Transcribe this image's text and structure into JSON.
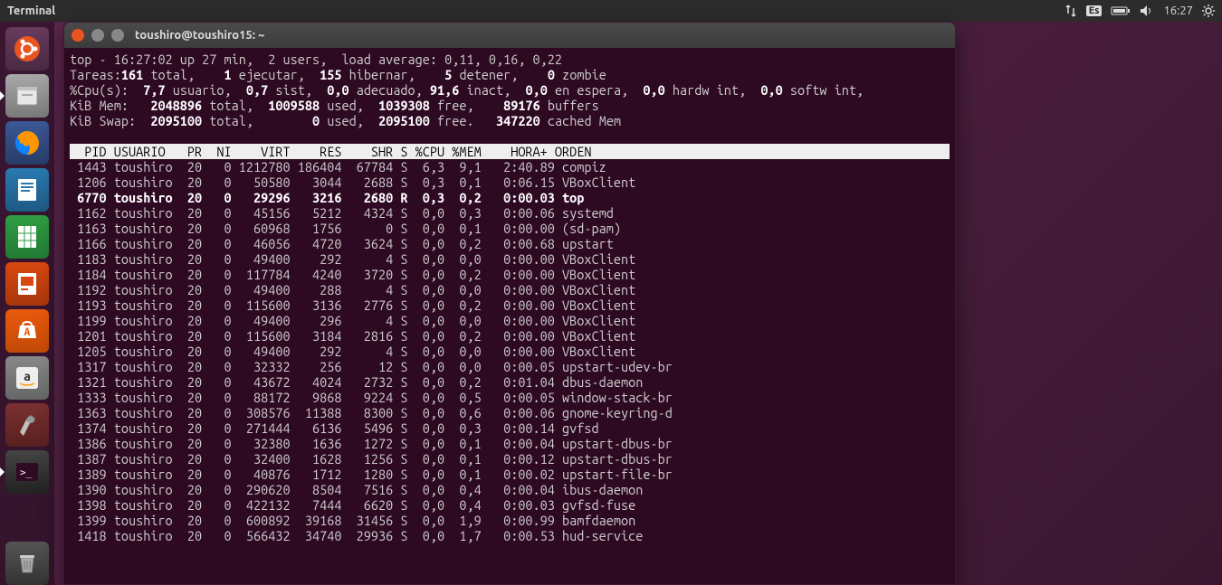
{
  "menubar": {
    "app_title": "Terminal",
    "lang": "Es",
    "clock": "16:27"
  },
  "launcher": {
    "items": [
      {
        "name": "files-icon"
      },
      {
        "name": "firefox-icon"
      },
      {
        "name": "writer-icon"
      },
      {
        "name": "calc-icon"
      },
      {
        "name": "impress-icon"
      },
      {
        "name": "software-icon"
      },
      {
        "name": "amazon-icon"
      },
      {
        "name": "settings-icon"
      },
      {
        "name": "terminal-icon"
      }
    ],
    "trash": "trash-icon"
  },
  "terminal": {
    "title": "toushiro@toushiro15: ~",
    "header": {
      "line1_pre": "top - 16:27:02 up 27 min,  2 users,  load average: 0,11, 0,16, 0,22",
      "tasks_label": "Tareas:",
      "tasks_total": "161",
      "tasks_total_sfx": " total,  ",
      "tasks_run": "  1",
      "tasks_run_sfx": " ejecutar,  ",
      "tasks_sleep": "155",
      "tasks_sleep_sfx": " hibernar,   ",
      "tasks_stop": " 5",
      "tasks_stop_sfx": " detener,   ",
      "tasks_zomb": " 0",
      "tasks_zomb_sfx": " zombie",
      "cpu_label": "%Cpu(s): ",
      "cpu_us": " 7,7",
      "cpu_us_sfx": " usuario, ",
      "cpu_sy": " 0,7",
      "cpu_sy_sfx": " sist, ",
      "cpu_ni": " 0,0",
      "cpu_ni_sfx": " adecuado,",
      "cpu_id": " 91,6",
      "cpu_id_sfx": " inact, ",
      "cpu_wa": " 0,0",
      "cpu_wa_sfx": " en espera, ",
      "cpu_hi": " 0,0",
      "cpu_hi_sfx": " hardw int, ",
      "cpu_si": " 0,0",
      "cpu_si_sfx": " softw int,",
      "mem_label": "KiB Mem:  ",
      "mem_total": " 2048896",
      "mem_total_sfx": " total, ",
      "mem_used": " 1009588",
      "mem_used_sfx": " used, ",
      "mem_free": " 1039308",
      "mem_free_sfx": " free,   ",
      "mem_buf": " 89176",
      "mem_buf_sfx": " buffers",
      "swap_label": "KiB Swap: ",
      "swap_total": " 2095100",
      "swap_total_sfx": " total,       ",
      "swap_used": " 0",
      "swap_used_sfx": " used, ",
      "swap_free": " 2095100",
      "swap_free_sfx": " free.  ",
      "swap_cache": " 347220",
      "swap_cache_sfx": " cached Mem"
    },
    "columns_line": "  PID USUARIO   PR  NI    VIRT    RES    SHR S %CPU %MEM    HORA+ ORDEN                                                                ",
    "processes": [
      {
        "pid": " 1443",
        "user": "toushiro",
        "pr": "20",
        "ni": "  0",
        "virt": "1212780",
        "res": "186404",
        "shr": " 67784",
        "s": "S",
        "cpu": " 6,3",
        "mem": " 9,1",
        "time": "  2:40.89",
        "cmd": "compiz",
        "bold": false
      },
      {
        "pid": " 1206",
        "user": "toushiro",
        "pr": "20",
        "ni": "  0",
        "virt": "  50580",
        "res": "  3044",
        "shr": "  2688",
        "s": "S",
        "cpu": " 0,3",
        "mem": " 0,1",
        "time": "  0:06.15",
        "cmd": "VBoxClient",
        "bold": false
      },
      {
        "pid": " 6770",
        "user": "toushiro",
        "pr": "20",
        "ni": "  0",
        "virt": "  29296",
        "res": "  3216",
        "shr": "  2680",
        "s": "R",
        "cpu": " 0,3",
        "mem": " 0,2",
        "time": "  0:00.03",
        "cmd": "top",
        "bold": true
      },
      {
        "pid": " 1162",
        "user": "toushiro",
        "pr": "20",
        "ni": "  0",
        "virt": "  45156",
        "res": "  5212",
        "shr": "  4324",
        "s": "S",
        "cpu": " 0,0",
        "mem": " 0,3",
        "time": "  0:00.06",
        "cmd": "systemd",
        "bold": false
      },
      {
        "pid": " 1163",
        "user": "toushiro",
        "pr": "20",
        "ni": "  0",
        "virt": "  60968",
        "res": "  1756",
        "shr": "     0",
        "s": "S",
        "cpu": " 0,0",
        "mem": " 0,1",
        "time": "  0:00.00",
        "cmd": "(sd-pam)",
        "bold": false
      },
      {
        "pid": " 1166",
        "user": "toushiro",
        "pr": "20",
        "ni": "  0",
        "virt": "  46056",
        "res": "  4720",
        "shr": "  3624",
        "s": "S",
        "cpu": " 0,0",
        "mem": " 0,2",
        "time": "  0:00.68",
        "cmd": "upstart",
        "bold": false
      },
      {
        "pid": " 1183",
        "user": "toushiro",
        "pr": "20",
        "ni": "  0",
        "virt": "  49400",
        "res": "   292",
        "shr": "     4",
        "s": "S",
        "cpu": " 0,0",
        "mem": " 0,0",
        "time": "  0:00.00",
        "cmd": "VBoxClient",
        "bold": false
      },
      {
        "pid": " 1184",
        "user": "toushiro",
        "pr": "20",
        "ni": "  0",
        "virt": " 117784",
        "res": "  4240",
        "shr": "  3720",
        "s": "S",
        "cpu": " 0,0",
        "mem": " 0,2",
        "time": "  0:00.00",
        "cmd": "VBoxClient",
        "bold": false
      },
      {
        "pid": " 1192",
        "user": "toushiro",
        "pr": "20",
        "ni": "  0",
        "virt": "  49400",
        "res": "   288",
        "shr": "     4",
        "s": "S",
        "cpu": " 0,0",
        "mem": " 0,0",
        "time": "  0:00.00",
        "cmd": "VBoxClient",
        "bold": false
      },
      {
        "pid": " 1193",
        "user": "toushiro",
        "pr": "20",
        "ni": "  0",
        "virt": " 115600",
        "res": "  3136",
        "shr": "  2776",
        "s": "S",
        "cpu": " 0,0",
        "mem": " 0,2",
        "time": "  0:00.00",
        "cmd": "VBoxClient",
        "bold": false
      },
      {
        "pid": " 1199",
        "user": "toushiro",
        "pr": "20",
        "ni": "  0",
        "virt": "  49400",
        "res": "   296",
        "shr": "     4",
        "s": "S",
        "cpu": " 0,0",
        "mem": " 0,0",
        "time": "  0:00.00",
        "cmd": "VBoxClient",
        "bold": false
      },
      {
        "pid": " 1201",
        "user": "toushiro",
        "pr": "20",
        "ni": "  0",
        "virt": " 115600",
        "res": "  3184",
        "shr": "  2816",
        "s": "S",
        "cpu": " 0,0",
        "mem": " 0,2",
        "time": "  0:00.00",
        "cmd": "VBoxClient",
        "bold": false
      },
      {
        "pid": " 1205",
        "user": "toushiro",
        "pr": "20",
        "ni": "  0",
        "virt": "  49400",
        "res": "   292",
        "shr": "     4",
        "s": "S",
        "cpu": " 0,0",
        "mem": " 0,0",
        "time": "  0:00.00",
        "cmd": "VBoxClient",
        "bold": false
      },
      {
        "pid": " 1317",
        "user": "toushiro",
        "pr": "20",
        "ni": "  0",
        "virt": "  32332",
        "res": "   256",
        "shr": "    12",
        "s": "S",
        "cpu": " 0,0",
        "mem": " 0,0",
        "time": "  0:00.05",
        "cmd": "upstart-udev-br",
        "bold": false
      },
      {
        "pid": " 1321",
        "user": "toushiro",
        "pr": "20",
        "ni": "  0",
        "virt": "  43672",
        "res": "  4024",
        "shr": "  2732",
        "s": "S",
        "cpu": " 0,0",
        "mem": " 0,2",
        "time": "  0:01.04",
        "cmd": "dbus-daemon",
        "bold": false
      },
      {
        "pid": " 1333",
        "user": "toushiro",
        "pr": "20",
        "ni": "  0",
        "virt": "  88172",
        "res": "  9868",
        "shr": "  9224",
        "s": "S",
        "cpu": " 0,0",
        "mem": " 0,5",
        "time": "  0:00.05",
        "cmd": "window-stack-br",
        "bold": false
      },
      {
        "pid": " 1363",
        "user": "toushiro",
        "pr": "20",
        "ni": "  0",
        "virt": " 308576",
        "res": " 11388",
        "shr": "  8300",
        "s": "S",
        "cpu": " 0,0",
        "mem": " 0,6",
        "time": "  0:00.06",
        "cmd": "gnome-keyring-d",
        "bold": false
      },
      {
        "pid": " 1374",
        "user": "toushiro",
        "pr": "20",
        "ni": "  0",
        "virt": " 271444",
        "res": "  6136",
        "shr": "  5496",
        "s": "S",
        "cpu": " 0,0",
        "mem": " 0,3",
        "time": "  0:00.14",
        "cmd": "gvfsd",
        "bold": false
      },
      {
        "pid": " 1386",
        "user": "toushiro",
        "pr": "20",
        "ni": "  0",
        "virt": "  32380",
        "res": "  1636",
        "shr": "  1272",
        "s": "S",
        "cpu": " 0,0",
        "mem": " 0,1",
        "time": "  0:00.04",
        "cmd": "upstart-dbus-br",
        "bold": false
      },
      {
        "pid": " 1387",
        "user": "toushiro",
        "pr": "20",
        "ni": "  0",
        "virt": "  32400",
        "res": "  1628",
        "shr": "  1256",
        "s": "S",
        "cpu": " 0,0",
        "mem": " 0,1",
        "time": "  0:00.12",
        "cmd": "upstart-dbus-br",
        "bold": false
      },
      {
        "pid": " 1389",
        "user": "toushiro",
        "pr": "20",
        "ni": "  0",
        "virt": "  40876",
        "res": "  1712",
        "shr": "  1280",
        "s": "S",
        "cpu": " 0,0",
        "mem": " 0,1",
        "time": "  0:00.02",
        "cmd": "upstart-file-br",
        "bold": false
      },
      {
        "pid": " 1390",
        "user": "toushiro",
        "pr": "20",
        "ni": "  0",
        "virt": " 290620",
        "res": "  8504",
        "shr": "  7516",
        "s": "S",
        "cpu": " 0,0",
        "mem": " 0,4",
        "time": "  0:00.04",
        "cmd": "ibus-daemon",
        "bold": false
      },
      {
        "pid": " 1398",
        "user": "toushiro",
        "pr": "20",
        "ni": "  0",
        "virt": " 422132",
        "res": "  7444",
        "shr": "  6620",
        "s": "S",
        "cpu": " 0,0",
        "mem": " 0,4",
        "time": "  0:00.03",
        "cmd": "gvfsd-fuse",
        "bold": false
      },
      {
        "pid": " 1399",
        "user": "toushiro",
        "pr": "20",
        "ni": "  0",
        "virt": " 600892",
        "res": " 39168",
        "shr": " 31456",
        "s": "S",
        "cpu": " 0,0",
        "mem": " 1,9",
        "time": "  0:00.99",
        "cmd": "bamfdaemon",
        "bold": false
      },
      {
        "pid": " 1418",
        "user": "toushiro",
        "pr": "20",
        "ni": "  0",
        "virt": " 566432",
        "res": " 34740",
        "shr": " 29936",
        "s": "S",
        "cpu": " 0,0",
        "mem": " 1,7",
        "time": "  0:00.53",
        "cmd": "hud-service",
        "bold": false
      }
    ]
  }
}
